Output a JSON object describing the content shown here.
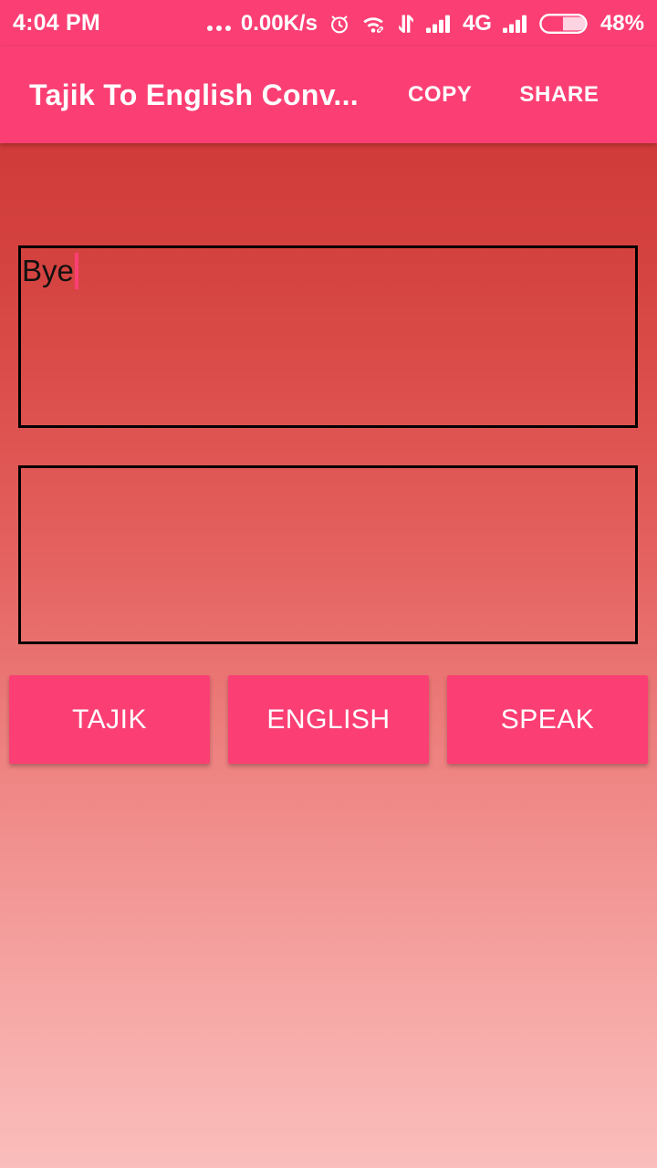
{
  "status_bar": {
    "time": "4:04 PM",
    "overflow_icon": "more-dots-icon",
    "network_speed": "0.00K/s",
    "alarm_icon": "alarm-clock-icon",
    "wifi_icon": "wifi-icon",
    "data_transfer_icon": "data-transfer-arrows-icon",
    "signal_1_icon": "signal-bars-icon",
    "network_type": "4G",
    "signal_2_icon": "signal-bars-icon",
    "battery_icon": "battery-icon",
    "battery_percent": "48%",
    "background_color": "#fb3f74",
    "foreground_color": "#ffffff"
  },
  "app_bar": {
    "title": "Tajik To English Conv...",
    "copy_label": "COPY",
    "share_label": "SHARE",
    "background_color": "#fb3f74"
  },
  "main": {
    "input": {
      "value": "Bye",
      "placeholder": "",
      "caret_color": "#fb3f74",
      "border_color": "#000000"
    },
    "output": {
      "value": "",
      "placeholder": "",
      "border_color": "#000000"
    },
    "buttons": [
      {
        "label": "TAJIK",
        "name": "tajik-button"
      },
      {
        "label": "ENGLISH",
        "name": "english-button"
      },
      {
        "label": "SPEAK",
        "name": "speak-button"
      }
    ],
    "button_color": "#fb3f74",
    "background_gradient_from": "#c9302c",
    "background_gradient_to": "#fabdbb"
  }
}
